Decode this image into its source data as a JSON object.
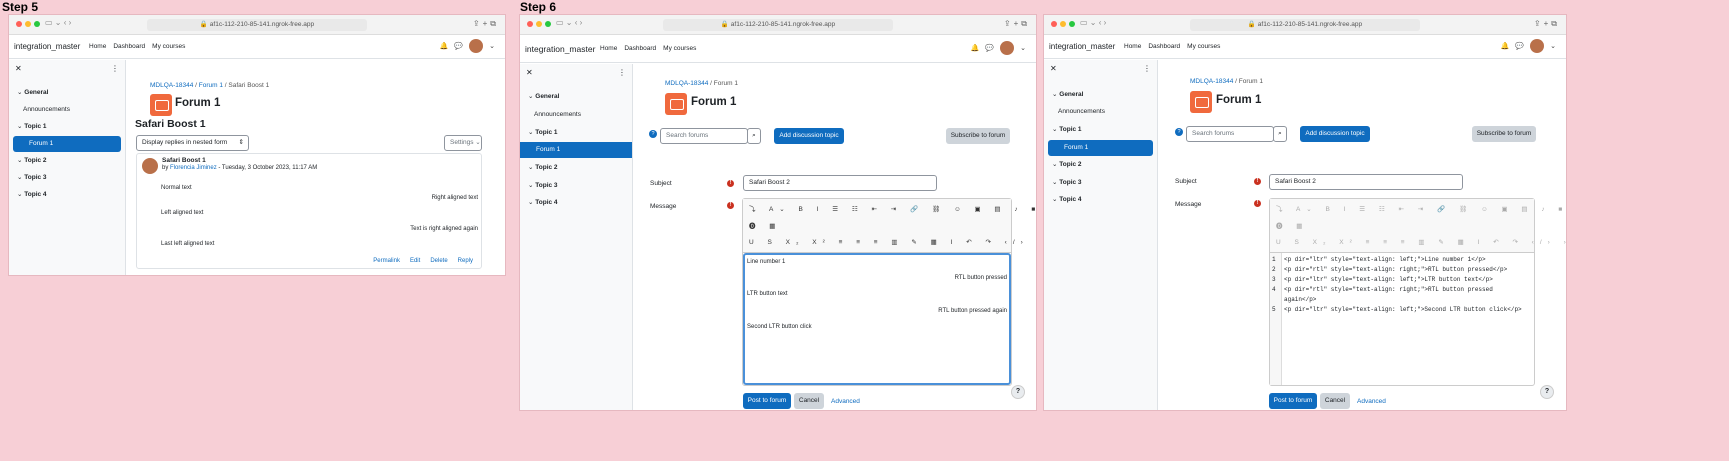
{
  "steps": [
    {
      "label": "Step 5",
      "url": "af1c-112-210-85-141.ngrok-free.app",
      "brand": "integration_master",
      "nav": [
        "Home",
        "Dashboard",
        "My courses"
      ],
      "drawer": [
        {
          "kind": "sec",
          "label": "General"
        },
        {
          "kind": "sub",
          "label": "Announcements"
        },
        {
          "kind": "sec",
          "label": "Topic 1"
        },
        {
          "kind": "active",
          "label": "Forum 1"
        },
        {
          "kind": "sec",
          "label": "Topic 2"
        },
        {
          "kind": "sec",
          "label": "Topic 3"
        },
        {
          "kind": "sec",
          "label": "Topic 4"
        }
      ],
      "breadcrumb": [
        "MDLQA-18344",
        "Forum 1",
        "Safari Boost 1"
      ],
      "forum_title": "Forum 1",
      "discussion_title": "Safari Boost 1",
      "display_mode": "Display replies in nested form",
      "settings_label": "Settings",
      "post": {
        "subject": "Safari Boost 1",
        "by_prefix": "by",
        "author": "Florencia Jiminez",
        "date": "- Tuesday, 3 October 2023, 11:17 AM",
        "lines": [
          {
            "text": "Normal text",
            "align": "left"
          },
          {
            "text": "Right aligned text",
            "align": "right"
          },
          {
            "text": "Left aligned text",
            "align": "left"
          },
          {
            "text": "Text is right aligned again",
            "align": "right"
          },
          {
            "text": "Last left aligned text",
            "align": "left"
          }
        ],
        "actions": [
          "Permalink",
          "Edit",
          "Delete",
          "Reply"
        ]
      }
    },
    {
      "label": "Step 6",
      "url": "af1c-112-210-85-141.ngrok-free.app",
      "brand": "integration_master",
      "nav": [
        "Home",
        "Dashboard",
        "My courses"
      ],
      "drawer": [
        {
          "kind": "sec",
          "label": "General"
        },
        {
          "kind": "sub",
          "label": "Announcements"
        },
        {
          "kind": "sec",
          "label": "Topic 1"
        },
        {
          "kind": "active",
          "label": "Forum 1"
        },
        {
          "kind": "sec",
          "label": "Topic 2"
        },
        {
          "kind": "sec",
          "label": "Topic 3"
        },
        {
          "kind": "sec",
          "label": "Topic 4"
        }
      ],
      "breadcrumb": [
        "MDLQA-18344",
        "Forum 1"
      ],
      "forum_title": "Forum 1",
      "search_placeholder": "Search forums",
      "add_topic": "Add discussion topic",
      "subscribe": "Subscribe to forum",
      "subject_label": "Subject",
      "subject_value": "Safari Boost 2",
      "message_label": "Message",
      "editor_lines": [
        {
          "text": "Line number 1",
          "align": "left"
        },
        {
          "text": "RTL button pressed",
          "align": "right"
        },
        {
          "text": "LTR button text",
          "align": "left"
        },
        {
          "text": "RTL button pressed again",
          "align": "right"
        },
        {
          "text": "Second LTR button click",
          "align": "left"
        }
      ],
      "post_btn": "Post to forum",
      "cancel_btn": "Cancel",
      "advanced": "Advanced"
    },
    {
      "url": "af1c-112-210-85-141.ngrok-free.app",
      "brand": "integration_master",
      "nav": [
        "Home",
        "Dashboard",
        "My courses"
      ],
      "drawer": [
        {
          "kind": "sec",
          "label": "General"
        },
        {
          "kind": "sub",
          "label": "Announcements"
        },
        {
          "kind": "sec",
          "label": "Topic 1"
        },
        {
          "kind": "active",
          "label": "Forum 1"
        },
        {
          "kind": "sec",
          "label": "Topic 2"
        },
        {
          "kind": "sec",
          "label": "Topic 3"
        },
        {
          "kind": "sec",
          "label": "Topic 4"
        }
      ],
      "breadcrumb": [
        "MDLQA-18344",
        "Forum 1"
      ],
      "forum_title": "Forum 1",
      "search_placeholder": "Search forums",
      "add_topic": "Add discussion topic",
      "subscribe": "Subscribe to forum",
      "subject_label": "Subject",
      "subject_value": "Safari Boost 2",
      "message_label": "Message",
      "code_lines": [
        "<p dir=\"ltr\" style=\"text-align: left;\">Line number 1</p>",
        "<p dir=\"rtl\" style=\"text-align: right;\">RTL button pressed</p>",
        "<p dir=\"ltr\" style=\"text-align: left;\">LTR button text</p>",
        "<p dir=\"rtl\" style=\"text-align: right;\">RTL button pressed again</p>",
        "<p dir=\"ltr\" style=\"text-align: left;\">Second LTR button click</p>"
      ],
      "post_btn": "Post to forum",
      "cancel_btn": "Cancel",
      "advanced": "Advanced"
    }
  ]
}
